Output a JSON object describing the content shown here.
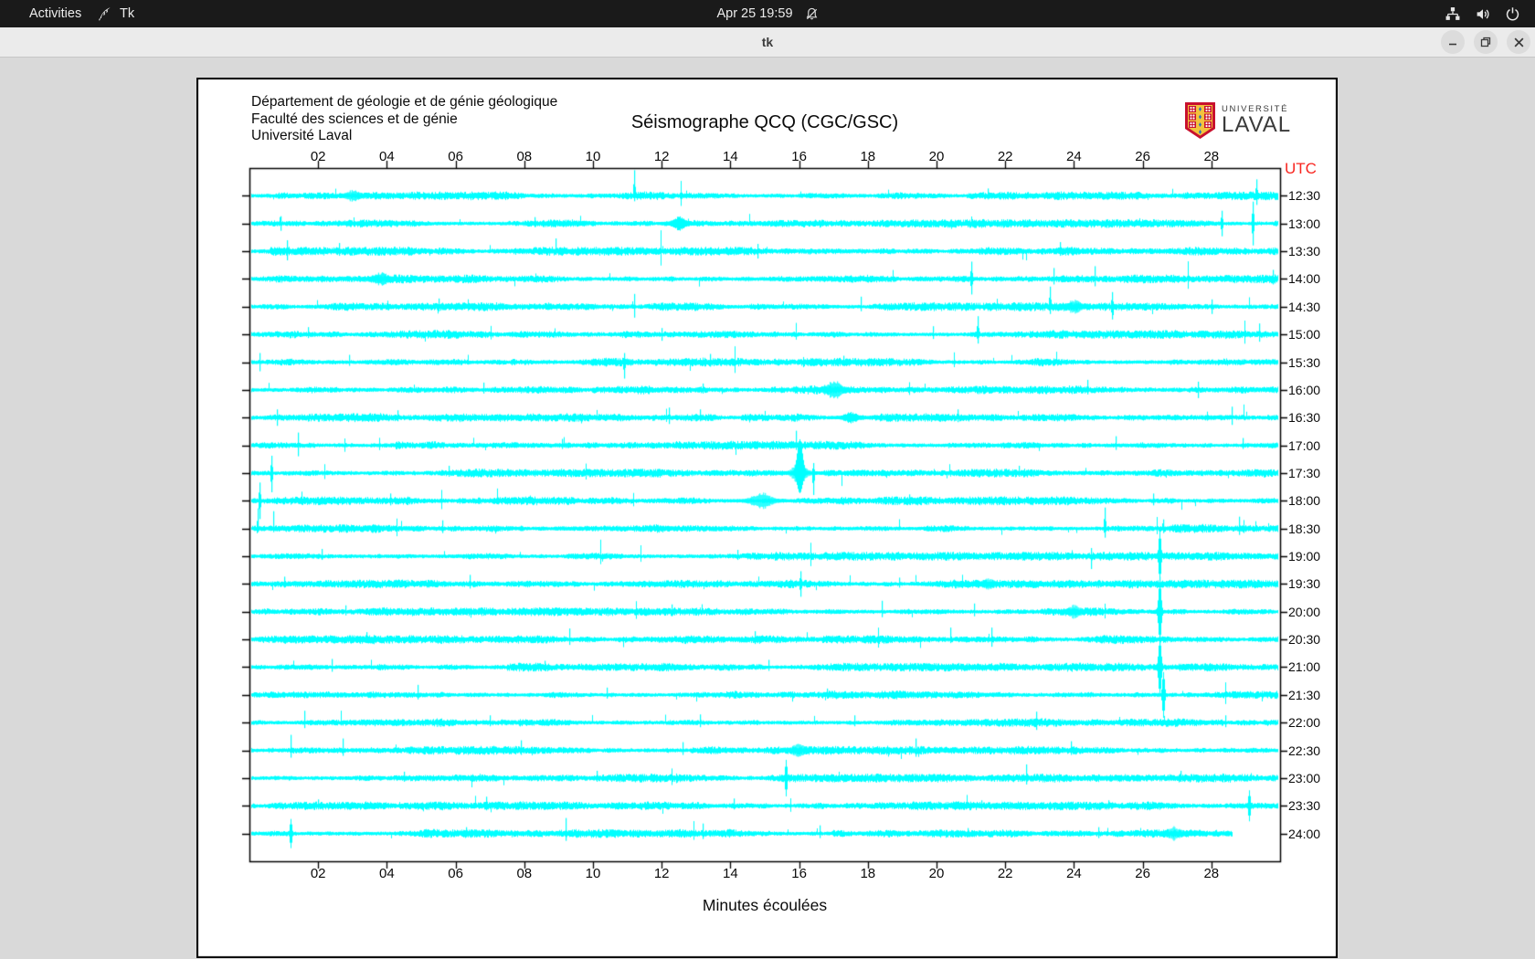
{
  "topbar": {
    "activities": "Activities",
    "app_name": "Tk",
    "clock": "Apr 25 19:59",
    "icons": [
      "tk-feather-icon",
      "bell-muted-icon",
      "network-wired-icon",
      "volume-icon",
      "power-icon"
    ]
  },
  "titlebar": {
    "title": "tk",
    "buttons": [
      "minimize",
      "restore",
      "close"
    ]
  },
  "header": {
    "line1": "Département de géologie et de génie géologique",
    "line2": "Faculté des sciences et de génie",
    "line3": "Université Laval"
  },
  "logo": {
    "univ": "UNIVERSITÉ",
    "name": "LAVAL"
  },
  "chart_data": {
    "type": "seismograph-helicorder",
    "title": "Séismographe QCQ (CGC/GSC)",
    "xlabel": "Minutes écoulées",
    "utc_label": "UTC",
    "x_ticks": [
      "02",
      "04",
      "06",
      "08",
      "10",
      "12",
      "14",
      "16",
      "18",
      "20",
      "22",
      "24",
      "26",
      "28"
    ],
    "x_range_minutes": [
      0,
      30
    ],
    "row_labels": [
      "12:30",
      "13:00",
      "13:30",
      "14:00",
      "14:30",
      "15:00",
      "15:30",
      "16:00",
      "16:30",
      "17:00",
      "17:30",
      "18:00",
      "18:30",
      "19:00",
      "19:30",
      "20:00",
      "20:30",
      "21:00",
      "21:30",
      "22:00",
      "22:30",
      "23:00",
      "23:30",
      "24:00"
    ],
    "last_row_end_minute": 28.6,
    "trace_color": "#00ffff",
    "utc_color": "#f8251f",
    "noise_seed": 7,
    "events": [
      [
        0,
        11.2,
        28,
        6
      ],
      [
        0,
        21.5,
        8,
        4
      ],
      [
        0,
        29.3,
        18,
        10
      ],
      [
        1,
        0.9,
        8,
        8
      ],
      [
        1,
        8.3,
        7,
        4
      ],
      [
        1,
        28.3,
        14,
        14
      ],
      [
        1,
        29.2,
        24,
        24
      ],
      [
        2,
        1.1,
        12,
        10
      ],
      [
        2,
        2.6,
        9,
        5
      ],
      [
        2,
        8.9,
        14,
        4
      ],
      [
        2,
        14.8,
        8,
        8
      ],
      [
        2,
        23.6,
        10,
        5
      ],
      [
        3,
        21.0,
        19,
        17
      ],
      [
        3,
        23.4,
        12,
        6
      ],
      [
        3,
        24.6,
        14,
        8
      ],
      [
        3,
        29.8,
        10,
        6
      ],
      [
        4,
        5.5,
        9,
        5
      ],
      [
        4,
        11.2,
        14,
        12
      ],
      [
        4,
        17.8,
        11,
        5
      ],
      [
        4,
        23.3,
        22,
        8
      ],
      [
        4,
        25.1,
        16,
        14
      ],
      [
        4,
        28.0,
        8,
        8
      ],
      [
        5,
        1.7,
        8,
        4
      ],
      [
        5,
        12.0,
        7,
        7
      ],
      [
        5,
        19.9,
        9,
        5
      ],
      [
        5,
        21.2,
        20,
        10
      ],
      [
        5,
        29.4,
        12,
        8
      ],
      [
        6,
        0.3,
        10,
        10
      ],
      [
        6,
        2.9,
        8,
        4
      ],
      [
        6,
        10.9,
        10,
        18
      ],
      [
        6,
        13.4,
        9,
        5
      ],
      [
        6,
        17.3,
        7,
        4
      ],
      [
        7,
        6.8,
        8,
        4
      ],
      [
        7,
        13.2,
        7,
        4
      ],
      [
        7,
        24.4,
        11,
        5
      ],
      [
        7,
        27.6,
        9,
        9
      ],
      [
        8,
        0.8,
        9,
        9
      ],
      [
        8,
        4.3,
        8,
        4
      ],
      [
        8,
        12.2,
        11,
        7
      ],
      [
        8,
        13.1,
        9,
        4
      ],
      [
        8,
        20.6,
        9,
        5
      ],
      [
        8,
        28.6,
        12,
        8
      ],
      [
        9,
        1.4,
        14,
        12
      ],
      [
        9,
        9.1,
        7,
        4
      ],
      [
        9,
        15.9,
        16,
        5
      ],
      [
        9,
        25.2,
        10,
        5
      ],
      [
        9,
        28.9,
        8,
        4
      ],
      [
        10,
        0.65,
        19,
        21
      ],
      [
        10,
        5.8,
        8,
        4
      ],
      [
        10,
        16.0,
        36,
        21,
        4
      ],
      [
        10,
        16.4,
        11,
        24
      ],
      [
        10,
        22.4,
        8,
        4
      ],
      [
        11,
        0.3,
        20,
        20
      ],
      [
        11,
        4.1,
        8,
        5
      ],
      [
        11,
        19.2,
        7,
        4
      ],
      [
        11,
        26.3,
        8,
        5
      ],
      [
        12,
        0.25,
        22,
        4
      ],
      [
        12,
        0.7,
        19,
        4
      ],
      [
        12,
        5.6,
        9,
        5
      ],
      [
        12,
        24.9,
        23,
        10
      ],
      [
        12,
        26.6,
        10,
        5
      ],
      [
        12,
        28.8,
        13,
        7
      ],
      [
        13,
        2.1,
        8,
        4
      ],
      [
        13,
        14.2,
        7,
        4
      ],
      [
        13,
        24.5,
        9,
        14
      ],
      [
        13,
        26.5,
        27,
        27,
        1.6
      ],
      [
        14,
        1.0,
        8,
        4
      ],
      [
        14,
        6.4,
        10,
        5
      ],
      [
        14,
        16.05,
        14,
        14
      ],
      [
        14,
        18.9,
        7,
        4
      ],
      [
        14,
        26.5,
        8,
        6
      ],
      [
        15,
        2.8,
        7,
        4
      ],
      [
        15,
        12.3,
        8,
        5
      ],
      [
        15,
        18.4,
        12,
        6
      ],
      [
        15,
        21.1,
        9,
        5
      ],
      [
        15,
        26.5,
        31,
        31,
        2
      ],
      [
        16,
        3.4,
        8,
        4
      ],
      [
        16,
        9.3,
        12,
        6
      ],
      [
        16,
        14.7,
        9,
        5
      ],
      [
        16,
        20.4,
        13,
        4
      ],
      [
        16,
        21.6,
        13,
        8
      ],
      [
        16,
        26.5,
        12,
        10
      ],
      [
        17,
        2.4,
        9,
        5
      ],
      [
        17,
        8.6,
        7,
        4
      ],
      [
        17,
        15.1,
        8,
        4
      ],
      [
        17,
        26.5,
        29,
        29,
        2
      ],
      [
        18,
        4.9,
        11,
        5
      ],
      [
        18,
        10.4,
        8,
        4
      ],
      [
        18,
        16.8,
        7,
        4
      ],
      [
        18,
        26.6,
        24,
        24,
        1.6
      ],
      [
        19,
        1.6,
        13,
        6
      ],
      [
        19,
        7.0,
        8,
        4
      ],
      [
        19,
        13.1,
        9,
        5
      ],
      [
        19,
        17.6,
        8,
        4
      ],
      [
        19,
        22.9,
        12,
        8
      ],
      [
        19,
        28.4,
        8,
        5
      ],
      [
        20,
        1.2,
        17,
        8
      ],
      [
        20,
        2.7,
        13,
        6
      ],
      [
        20,
        7.9,
        11,
        5
      ],
      [
        20,
        12.6,
        9,
        5
      ],
      [
        20,
        19.4,
        13,
        7
      ],
      [
        20,
        23.9,
        10,
        5
      ],
      [
        21,
        4.5,
        7,
        4
      ],
      [
        21,
        10.1,
        8,
        4
      ],
      [
        21,
        15.6,
        19,
        19,
        1.4
      ],
      [
        21,
        22.6,
        15,
        7
      ],
      [
        21,
        27.1,
        8,
        4
      ],
      [
        22,
        2.0,
        7,
        4
      ],
      [
        22,
        6.9,
        10,
        5
      ],
      [
        22,
        14.1,
        8,
        4
      ],
      [
        22,
        21.3,
        6,
        4
      ],
      [
        22,
        25.0,
        6,
        4
      ],
      [
        22,
        29.1,
        16,
        16,
        1.4
      ],
      [
        23,
        1.2,
        15,
        15,
        1.4
      ],
      [
        23,
        6.3,
        7,
        4
      ],
      [
        23,
        9.2,
        17,
        8
      ],
      [
        23,
        13.2,
        11,
        6
      ],
      [
        23,
        16.6,
        9,
        5
      ],
      [
        23,
        20.9,
        6,
        4
      ],
      [
        23,
        24.7,
        7,
        5
      ]
    ],
    "bursts": [
      [
        0,
        3.0,
        4,
        8
      ],
      [
        1,
        12.5,
        5,
        8
      ],
      [
        3,
        3.8,
        5,
        9
      ],
      [
        4,
        24.0,
        5,
        8
      ],
      [
        7,
        17.0,
        7,
        11
      ],
      [
        8,
        17.5,
        4,
        8
      ],
      [
        10,
        16.0,
        9,
        8
      ],
      [
        11,
        14.9,
        6,
        12
      ],
      [
        14,
        21.5,
        4,
        8
      ],
      [
        15,
        24.0,
        5,
        8
      ],
      [
        20,
        16.0,
        5,
        9
      ],
      [
        23,
        26.9,
        5,
        10
      ]
    ]
  }
}
